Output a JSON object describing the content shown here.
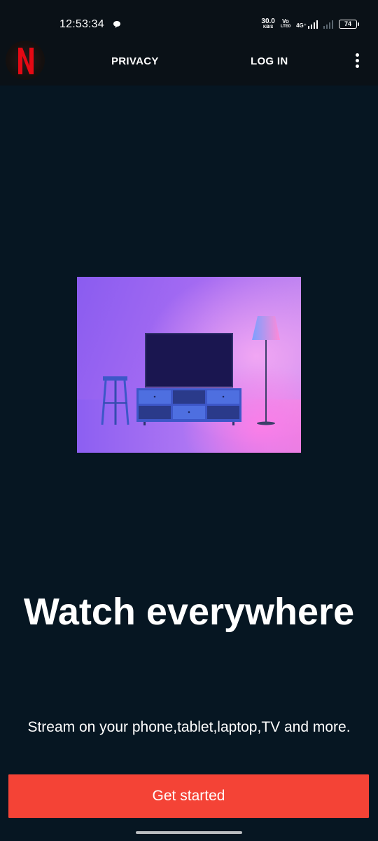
{
  "status_bar": {
    "time": "12:53:34",
    "net_speed_value": "30.0",
    "net_speed_unit": "KB/S",
    "volte_top": "Vo",
    "volte_bottom": "LTE0",
    "network_type": "4G⁺",
    "battery_level": "74",
    "icons": [
      "chat-icon",
      "signal-icon",
      "no-signal-icon",
      "battery-icon"
    ]
  },
  "app_bar": {
    "logo_letter": "N",
    "nav": {
      "privacy": "PRIVACY",
      "login": "LOG IN"
    },
    "more_icon": "more-vertical-icon"
  },
  "hero": {
    "image": "living-room-tv-illustration"
  },
  "content": {
    "headline": "Watch everywhere",
    "subheadline": "Stream on your phone,tablet,laptop,TV and more."
  },
  "cta": {
    "label": "Get started"
  },
  "colors": {
    "background": "#061622",
    "bar": "#0a1117",
    "brand_red": "#e50914",
    "cta": "#f44336",
    "text": "#ffffff"
  }
}
